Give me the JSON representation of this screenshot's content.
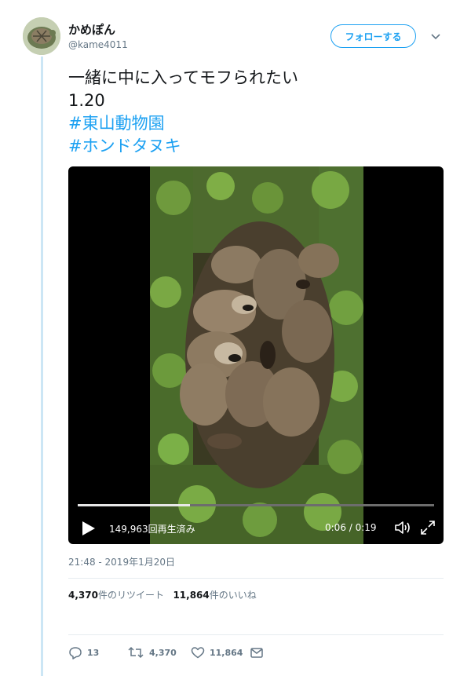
{
  "author": {
    "name": "かめぽん",
    "handle": "@kame4011",
    "follow_label": "フォローする"
  },
  "tweet": {
    "line1": "一緒に中に入ってモフられたい",
    "line2": "1.20",
    "hashtag1": "#東山動物園",
    "hashtag2": "#ホンドタヌキ"
  },
  "video": {
    "views": "149,963回再生済み",
    "time": "0:06 / 0:19",
    "progress": 0.316
  },
  "timestamp": "21:48 - 2019年1月20日",
  "stats": {
    "retweet_count": "4,370",
    "retweet_suffix": "件のリツイート",
    "like_count": "11,864",
    "like_suffix": "件のいいね"
  },
  "actions": {
    "reply_count": "13",
    "retweet_count": "4,370",
    "like_count": "11,864"
  },
  "colors": {
    "accent": "#1da1f2",
    "thread": "#cce6f5",
    "muted": "#657786"
  },
  "icons": [
    "caret-down-icon",
    "play-icon",
    "volume-icon",
    "fullscreen-icon",
    "reply-icon",
    "retweet-icon",
    "like-icon",
    "message-icon"
  ]
}
